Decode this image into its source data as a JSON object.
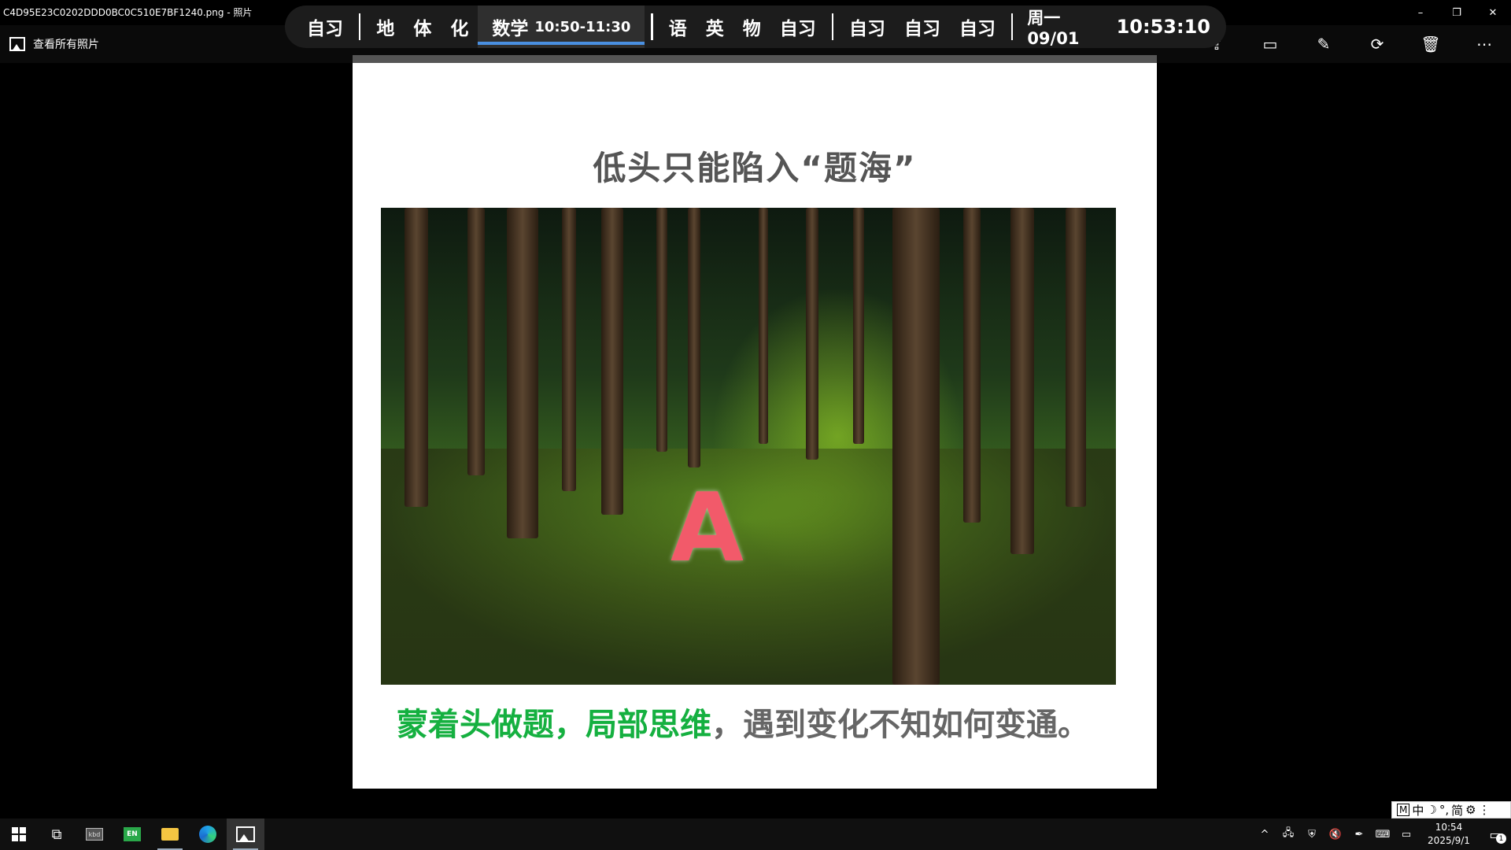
{
  "window": {
    "title": "C4D95E23C0202DDD0BC0C510E7BF1240.png - 照片",
    "controls": {
      "minimize": "–",
      "restore": "❐",
      "close": "✕"
    }
  },
  "toolbar": {
    "view_all_label": "查看所有照片",
    "icons": [
      "share-icon",
      "slideshow-icon",
      "edit-icon",
      "rotate-icon",
      "delete-icon",
      "more-icon"
    ],
    "icon_glyphs": {
      "share": "⇪",
      "slideshow": "▭",
      "edit": "✎",
      "rotate": "⟳",
      "delete": "🗑",
      "more": "⋯"
    }
  },
  "schedule": {
    "group1": [
      "自习"
    ],
    "group2": [
      "地",
      "体",
      "化"
    ],
    "active": {
      "label": "数学",
      "time": "10:50-11:30"
    },
    "group3": [
      "语",
      "英",
      "物",
      "自习"
    ],
    "group4": [
      "自习",
      "自习",
      "自习"
    ],
    "date": "周一 09/01",
    "clock": "10:53:10",
    "accent": "#4a90e2"
  },
  "photo": {
    "title": "低头只能陷入“题海”",
    "letter": "A",
    "caption_highlight": "蒙着头做题，局部思维",
    "caption_rest": "，遇到变化不知如何变通。",
    "highlight_color": "#15b040"
  },
  "ime": {
    "mode": "M",
    "lang": "中",
    "moon": "☽",
    "punct": "°,",
    "simplified": "简",
    "settings": "⚙",
    "more": "⋮"
  },
  "taskbar": {
    "apps": [
      "start-icon",
      "task-view-icon",
      "keyboard-app-icon",
      "en-app-icon",
      "file-explorer-icon",
      "edge-icon",
      "photos-icon"
    ],
    "en_label": "EN",
    "kb_label": "kbd",
    "tray_glyphs": {
      "chevron": "^",
      "network": "🖧",
      "shield": "⛨",
      "volume": "🔇",
      "pen": "✒",
      "keyboard": "⌨",
      "tablet": "▭"
    },
    "time": "10:54",
    "date": "2025/9/1",
    "notification_count": "1"
  }
}
